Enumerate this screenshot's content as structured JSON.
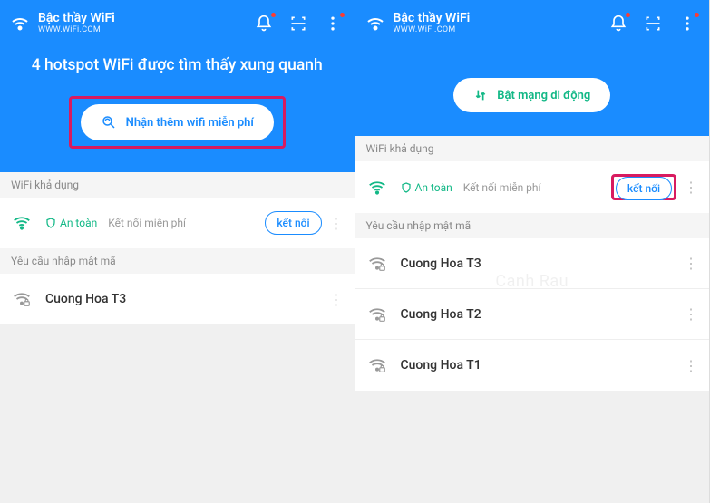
{
  "app": {
    "title": "Bậc thầy WiFi",
    "subtitle": "WWW.WiFi.COM"
  },
  "left": {
    "hero_title": "4 hotspot WiFi được tìm thấy xung quanh",
    "cta_label": "Nhận thêm wifi miễn phí",
    "section_available": "WiFi khả dụng",
    "safe_label": "An toàn",
    "free_connect_label": "Kết nối miễn phí",
    "connect_btn": "kết nối",
    "section_password": "Yêu cầu nhập mật mã",
    "networks_pw": [
      {
        "name": "Cuong Hoa T3"
      }
    ]
  },
  "right": {
    "cta_label": "Bật mạng di động",
    "section_available": "WiFi khả dụng",
    "safe_label": "An toàn",
    "free_connect_label": "Kết nối miễn phí",
    "connect_btn": "kết nối",
    "section_password": "Yêu cầu nhập mật mã",
    "networks_pw": [
      {
        "name": "Cuong Hoa T3"
      },
      {
        "name": "Cuong Hoa T2"
      },
      {
        "name": "Cuong Hoa T1"
      }
    ],
    "watermark": "Canh Rau"
  }
}
